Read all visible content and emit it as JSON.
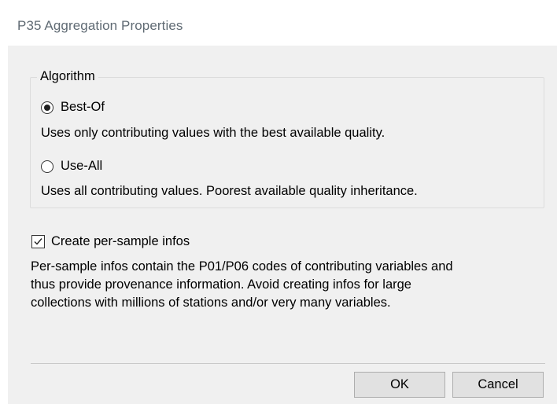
{
  "window": {
    "title": "P35 Aggregation Properties"
  },
  "algorithm_group": {
    "legend": "Algorithm",
    "options": [
      {
        "label": "Best-Of",
        "selected": true,
        "description": "Uses only contributing values with the best available quality."
      },
      {
        "label": "Use-All",
        "selected": false,
        "description": "Uses all contributing values. Poorest available quality inheritance."
      }
    ]
  },
  "per_sample": {
    "label": "Create per-sample infos",
    "checked": true,
    "description_lines": [
      "Per-sample infos contain the P01/P06 codes of contributing variables and",
      "thus provide provenance information. Avoid creating infos for large",
      "collections with millions of stations and/or very many variables."
    ]
  },
  "buttons": {
    "ok_label": "OK",
    "cancel_label": "Cancel"
  },
  "colors": {
    "title_text": "#5f6a73",
    "client_background": "#f0f0f0",
    "button_face": "#e1e1e1",
    "button_border": "#adadad"
  },
  "icons": {
    "checkbox_mark": "check-icon"
  }
}
